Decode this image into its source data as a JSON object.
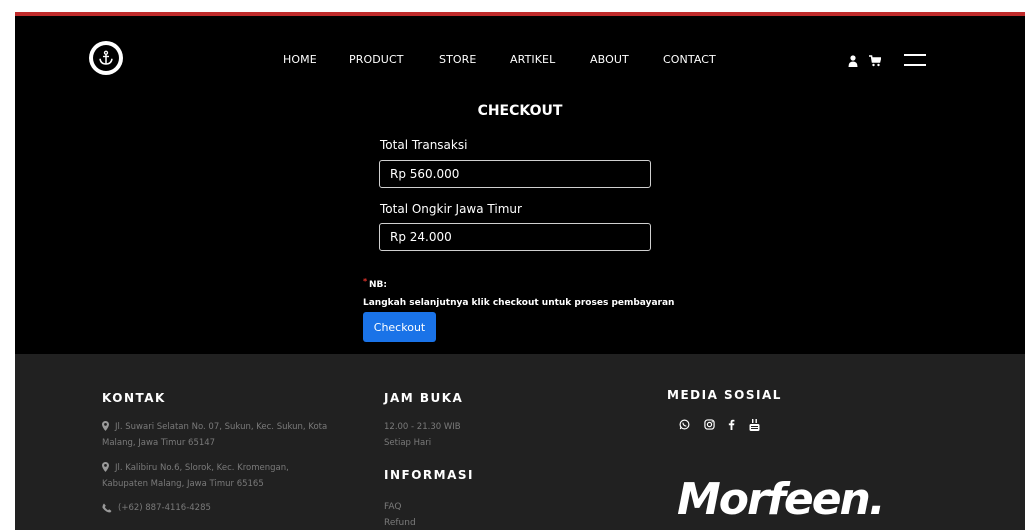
{
  "header": {
    "nav": [
      "HOME",
      "PRODUCT",
      "STORE",
      "ARTIKEL",
      "ABOUT",
      "CONTACT"
    ]
  },
  "checkout": {
    "title": "CHECKOUT",
    "total_label": "Total Transaksi",
    "total_value": "Rp 560.000",
    "ongkir_label": "Total Ongkir Jawa Timur",
    "ongkir_value": "Rp 24.000",
    "nb_label": "NB:",
    "nb_text": "Langkah selanjutnya klik checkout untuk proses pembayaran",
    "button_label": "Checkout"
  },
  "footer": {
    "kontak": {
      "title": "KONTAK",
      "address1_line1": "Jl. Suwari Selatan No. 07, Sukun, Kec. Sukun, Kota",
      "address1_line2": "Malang, Jawa Timur 65147",
      "address2_line1": "Jl. Kalibiru No.6, Slorok, Kec. Kromengan,",
      "address2_line2": "Kabupaten Malang, Jawa Timur 65165",
      "phone": "(+62) 887-4116-4285"
    },
    "jam_buka": {
      "title": "JAM BUKA",
      "hours": "12.00 - 21.30 WIB",
      "days": "Setiap Hari"
    },
    "informasi": {
      "title": "INFORMASI",
      "links": [
        "FAQ",
        "Refund"
      ]
    },
    "media_sosial": {
      "title": "MEDIA SOSIAL",
      "icons": [
        "whatsapp-icon",
        "instagram-icon",
        "facebook-icon",
        "youtube-icon"
      ]
    },
    "brand": "Morfeen."
  },
  "colors": {
    "accent_red": "#c02b2b",
    "button_blue": "#1a73e8",
    "footer_bg": "#212121"
  }
}
